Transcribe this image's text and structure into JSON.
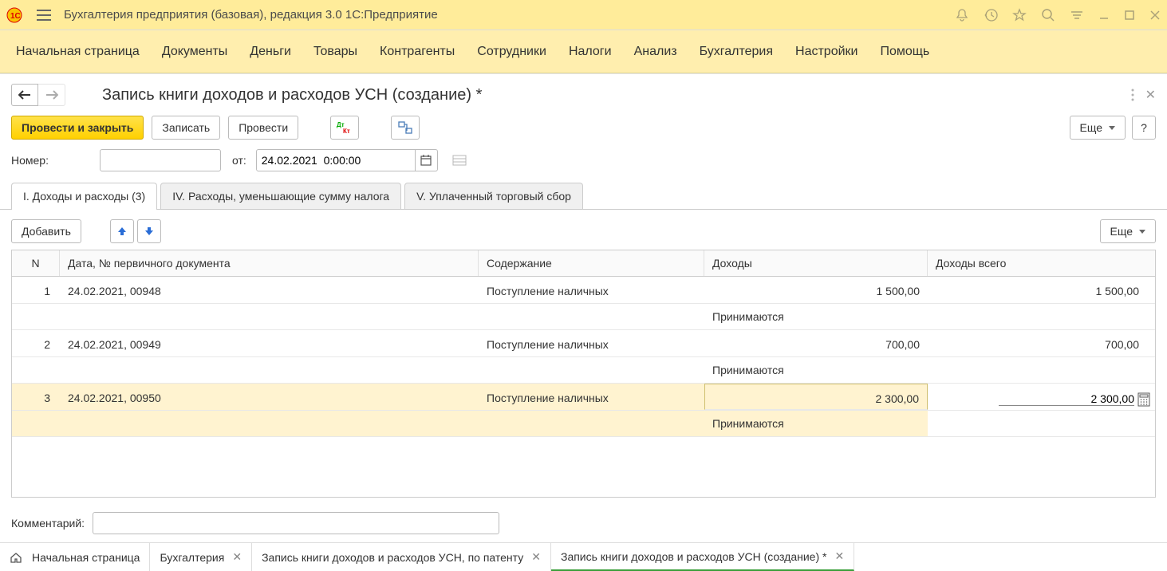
{
  "app_title": "Бухгалтерия предприятия (базовая), редакция 3.0 1С:Предприятие",
  "mainmenu": [
    "Начальная страница",
    "Документы",
    "Деньги",
    "Товары",
    "Контрагенты",
    "Сотрудники",
    "Налоги",
    "Анализ",
    "Бухгалтерия",
    "Настройки",
    "Помощь"
  ],
  "page_title": "Запись книги доходов и расходов УСН (создание) *",
  "toolbar": {
    "post_close": "Провести и закрыть",
    "save": "Записать",
    "post": "Провести",
    "more": "Еще",
    "help": "?"
  },
  "form": {
    "number_label": "Номер:",
    "number_value": "",
    "from_label": "от:",
    "date_value": "24.02.2021  0:00:00"
  },
  "tabs": {
    "t1": "I. Доходы и расходы (3)",
    "t2": "IV. Расходы, уменьшающие сумму налога",
    "t3": "V. Уплаченный торговый сбор"
  },
  "table_toolbar": {
    "add": "Добавить",
    "more": "Еще"
  },
  "columns": {
    "n": "N",
    "date": "Дата, № первичного документа",
    "desc": "Содержание",
    "income": "Доходы",
    "income_total": "Доходы всего"
  },
  "rows": [
    {
      "n": "1",
      "date": "24.02.2021, 00948",
      "desc": "Поступление наличных",
      "income": "1 500,00",
      "total": "1 500,00",
      "status": "Принимаются"
    },
    {
      "n": "2",
      "date": "24.02.2021, 00949",
      "desc": "Поступление наличных",
      "income": "700,00",
      "total": "700,00",
      "status": "Принимаются"
    },
    {
      "n": "3",
      "date": "24.02.2021, 00950",
      "desc": "Поступление наличных",
      "income": "2 300,00",
      "total": "2 300,00",
      "status": "Принимаются"
    }
  ],
  "comment_label": "Комментарий:",
  "comment_value": "",
  "bottom_tabs": [
    {
      "label": "Начальная страница",
      "home": true,
      "closable": false
    },
    {
      "label": "Бухгалтерия",
      "closable": true
    },
    {
      "label": "Запись книги доходов и расходов УСН, по патенту",
      "closable": true
    },
    {
      "label": "Запись книги доходов и расходов УСН (создание) *",
      "closable": true,
      "active": true
    }
  ]
}
